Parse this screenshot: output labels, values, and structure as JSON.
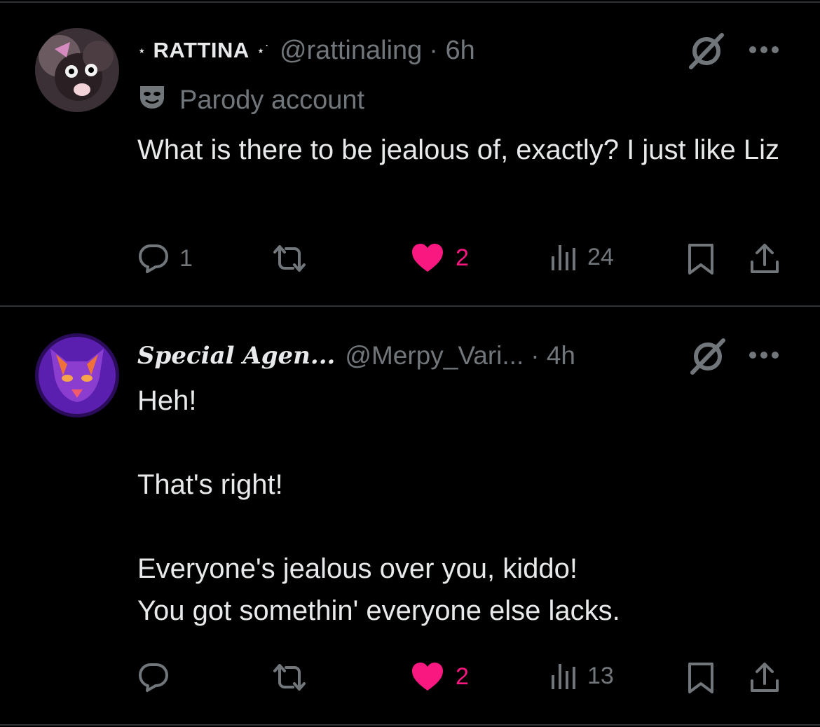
{
  "posts": [
    {
      "display_name": "RATTINA",
      "name_prefix": "⋆",
      "name_suffix": "⋆˙",
      "handle": "@rattinaling",
      "time": "· 6h",
      "label": "Parody account",
      "text": "What is there to be jealous of, exactly? I just like Liz",
      "reply_count": "1",
      "like_count": "2",
      "views_count": "24"
    },
    {
      "display_name": "Special Agen...",
      "handle": "@Merpy_Vari...",
      "time": "· 4h",
      "text": "Heh!\n\nThat's right!\n\nEveryone's jealous over you, kiddo!\nYou got somethin' everyone else lacks.",
      "reply_count": "",
      "like_count": "2",
      "views_count": "13"
    }
  ],
  "colors": {
    "background": "#000000",
    "text": "#e7e9ea",
    "muted": "#71767b",
    "like": "#f91880",
    "divider": "#2f3336"
  },
  "icons": [
    "grok-icon",
    "more-icon",
    "parody-mask-icon",
    "reply-icon",
    "repost-icon",
    "heart-icon",
    "views-icon",
    "bookmark-icon",
    "share-icon"
  ]
}
